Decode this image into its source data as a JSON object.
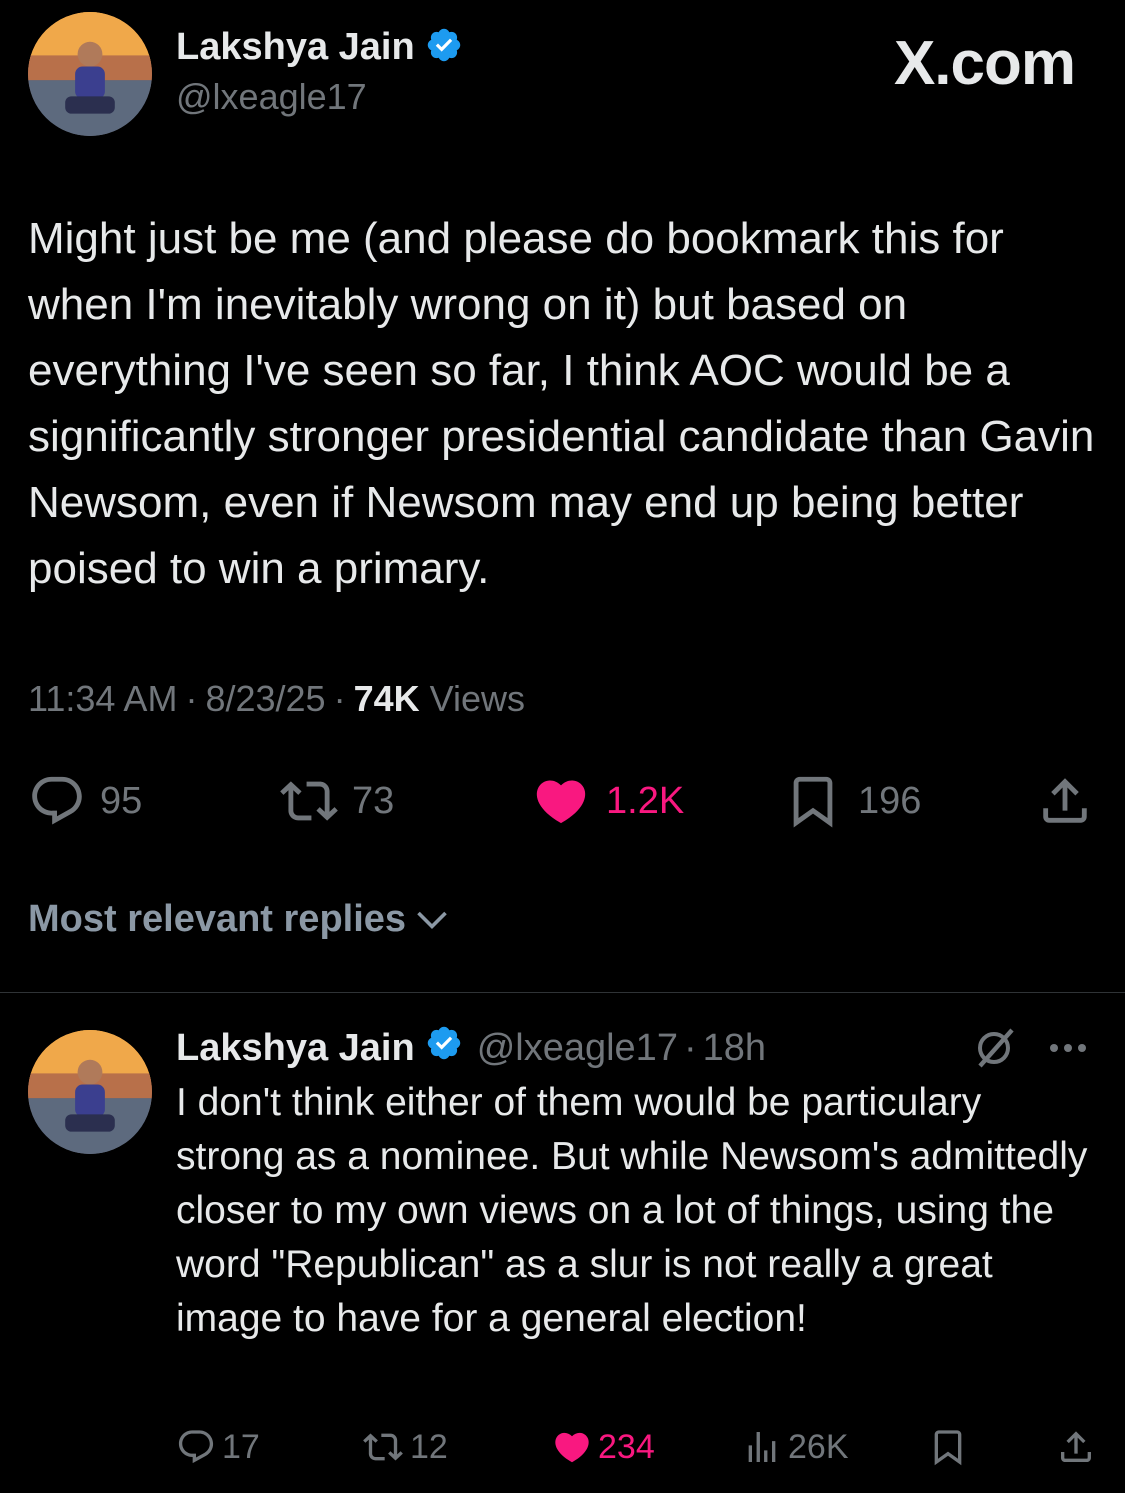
{
  "watermark": "X.com",
  "main_tweet": {
    "author_name": "Lakshya Jain",
    "handle": "@lxeagle17",
    "text": "Might just be me (and please do bookmark this for when I'm inevitably wrong on it) but based on everything I've seen so far, I think AOC would be a significantly stronger presidential candidate than Gavin Newsom, even if Newsom may end up being better poised to win a primary.",
    "time": "11:34 AM",
    "date": "8/23/25",
    "views_count": "74K",
    "views_label": "Views",
    "replies": "95",
    "reposts": "73",
    "likes": "1.2K",
    "bookmarks": "196"
  },
  "replies_sort": {
    "label": "Most relevant replies"
  },
  "reply_tweet": {
    "author_name": "Lakshya Jain",
    "handle": "@lxeagle17",
    "age": "18h",
    "text": "I don't think either of them would be particulary strong as a nominee. But while Newsom's admittedly closer to my own views on a lot of things, using the word \"Republican\" as a slur is not really a great image to have for a general election!",
    "replies": "17",
    "reposts": "12",
    "likes": "234",
    "views": "26K"
  },
  "icons": {
    "verified": "verified-badge-icon",
    "reply": "reply-icon",
    "repost": "repost-icon",
    "like": "heart-icon",
    "bookmark": "bookmark-icon",
    "share": "share-icon",
    "views": "analytics-icon",
    "grok": "grok-icon",
    "more": "more-icon",
    "chevron": "chevron-down-icon"
  },
  "colors": {
    "background": "#000000",
    "text": "#e7e9ea",
    "muted": "#71767b",
    "verified": "#1d9bf0",
    "like": "#f91880"
  }
}
